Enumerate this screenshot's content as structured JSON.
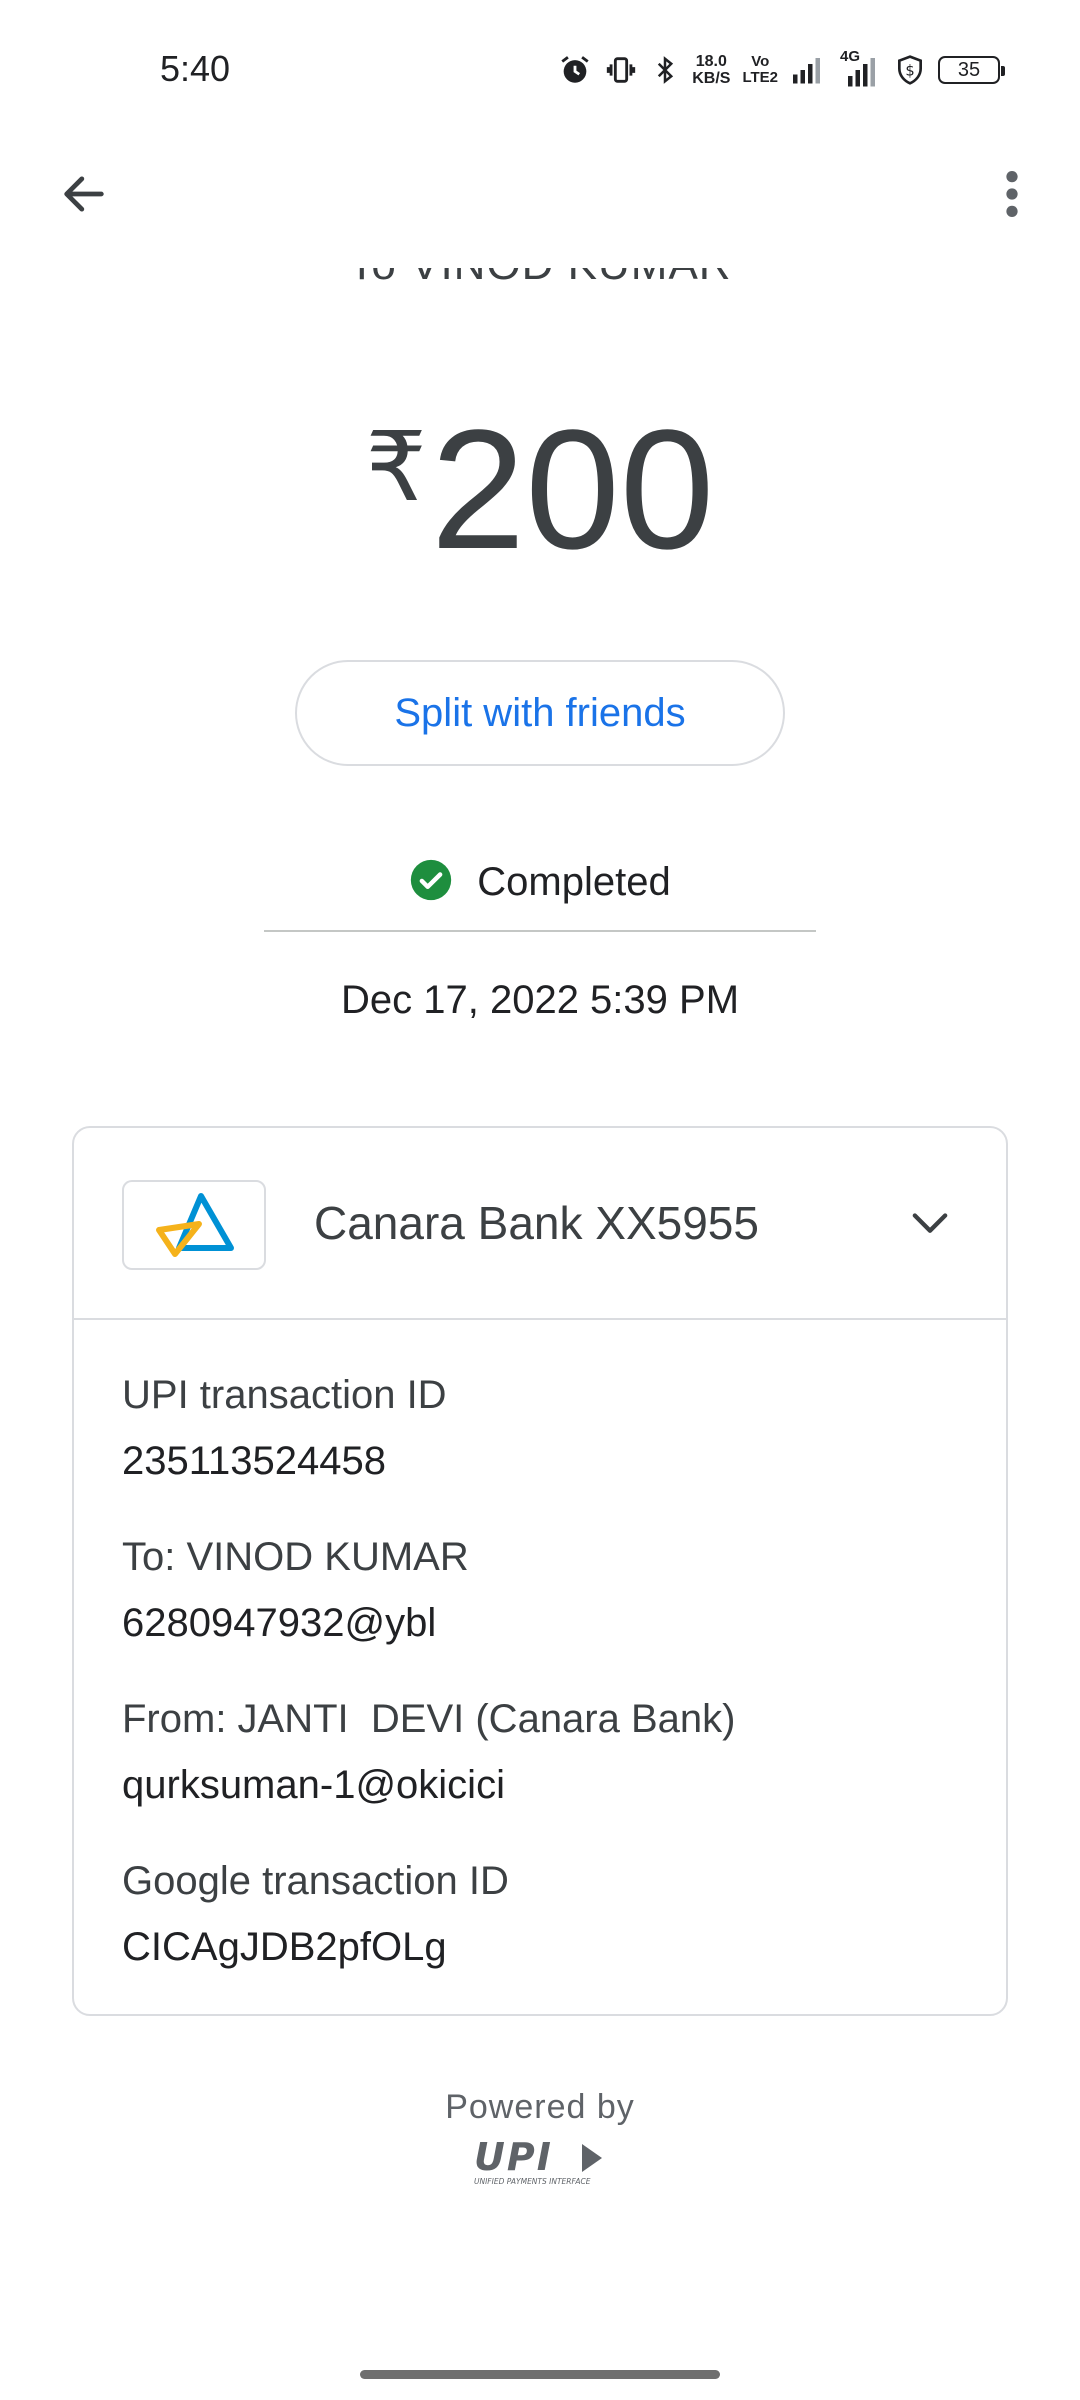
{
  "status_bar": {
    "time": "5:40",
    "speed_value": "18.0",
    "speed_unit": "KB/S",
    "volte_top": "Vo",
    "volte_bottom": "LTE2",
    "network_type": "4G",
    "battery_level": "35"
  },
  "transaction": {
    "recipient_line": "To VINOD KUMAR",
    "currency_symbol": "₹",
    "amount": "200",
    "split_button_label": "Split with friends",
    "status": "Completed",
    "datetime": "Dec 17, 2022 5:39 PM"
  },
  "details_card": {
    "bank_name": "Canara Bank XX5955",
    "items": [
      {
        "label": "UPI transaction ID",
        "value": "235113524458"
      },
      {
        "label": "To: VINOD KUMAR",
        "value": "6280947932@ybl"
      },
      {
        "label": "From: JANTI  DEVI (Canara Bank)",
        "value": "qurksuman-1@okicici"
      },
      {
        "label": "Google transaction ID",
        "value": "CICAgJDB2pfOLg"
      }
    ]
  },
  "footer": {
    "powered_by": "Powered by",
    "upi_logo": "UPI",
    "upi_tagline": "UNIFIED PAYMENTS INTERFACE"
  },
  "icons": {
    "back": "back-arrow-icon",
    "more": "more-vert-icon",
    "status_ok": "check-circle-icon",
    "expand": "chevron-down-icon"
  },
  "colors": {
    "accent": "#1a73e8",
    "success": "#1e8e3e",
    "text_primary": "#3c4043",
    "border": "#dadce0",
    "canara_blue": "#0091d5",
    "canara_yellow": "#f5b21b"
  }
}
